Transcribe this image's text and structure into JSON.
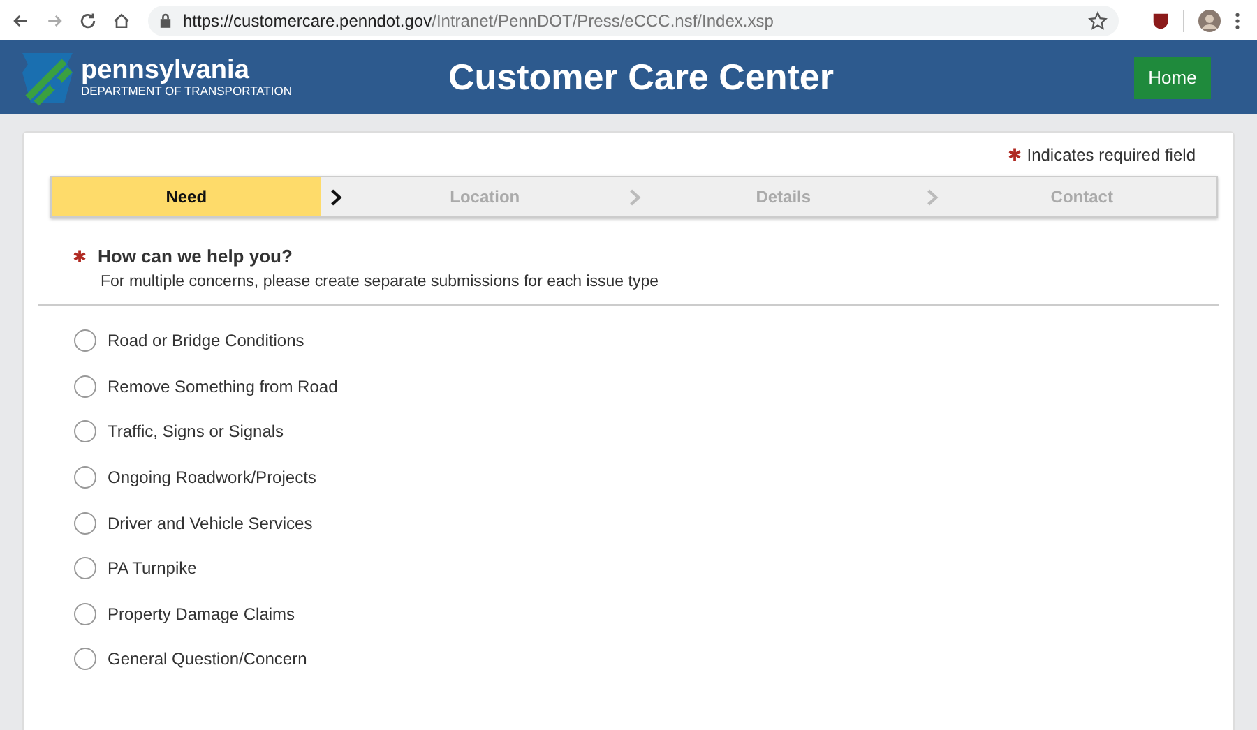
{
  "browser": {
    "url_host": "https://customercare.penndot.gov",
    "url_path": "/Intranet/PennDOT/Press/eCCC.nsf/Index.xsp"
  },
  "header": {
    "logo_name": "pennsylvania",
    "logo_sub": "DEPARTMENT OF TRANSPORTATION",
    "title": "Customer Care Center",
    "home_button": "Home"
  },
  "required_note": {
    "mark": "✱",
    "text": "Indicates required field"
  },
  "steps": [
    {
      "label": "Need",
      "selected": true
    },
    {
      "label": "Location",
      "selected": false
    },
    {
      "label": "Details",
      "selected": false
    },
    {
      "label": "Contact",
      "selected": false
    }
  ],
  "question": {
    "mark": "✱",
    "title": "How can we help you?",
    "hint": "For multiple concerns, please create separate submissions for each issue type"
  },
  "options": [
    {
      "label": "Road or Bridge Conditions",
      "selected": false
    },
    {
      "label": "Remove Something from Road",
      "selected": false
    },
    {
      "label": "Traffic, Signs or Signals",
      "selected": false
    },
    {
      "label": "Ongoing Roadwork/Projects",
      "selected": false
    },
    {
      "label": "Driver and Vehicle Services",
      "selected": false
    },
    {
      "label": "PA Turnpike",
      "selected": false
    },
    {
      "label": "Property Damage Claims",
      "selected": false
    },
    {
      "label": "General Question/Concern",
      "selected": false
    }
  ]
}
